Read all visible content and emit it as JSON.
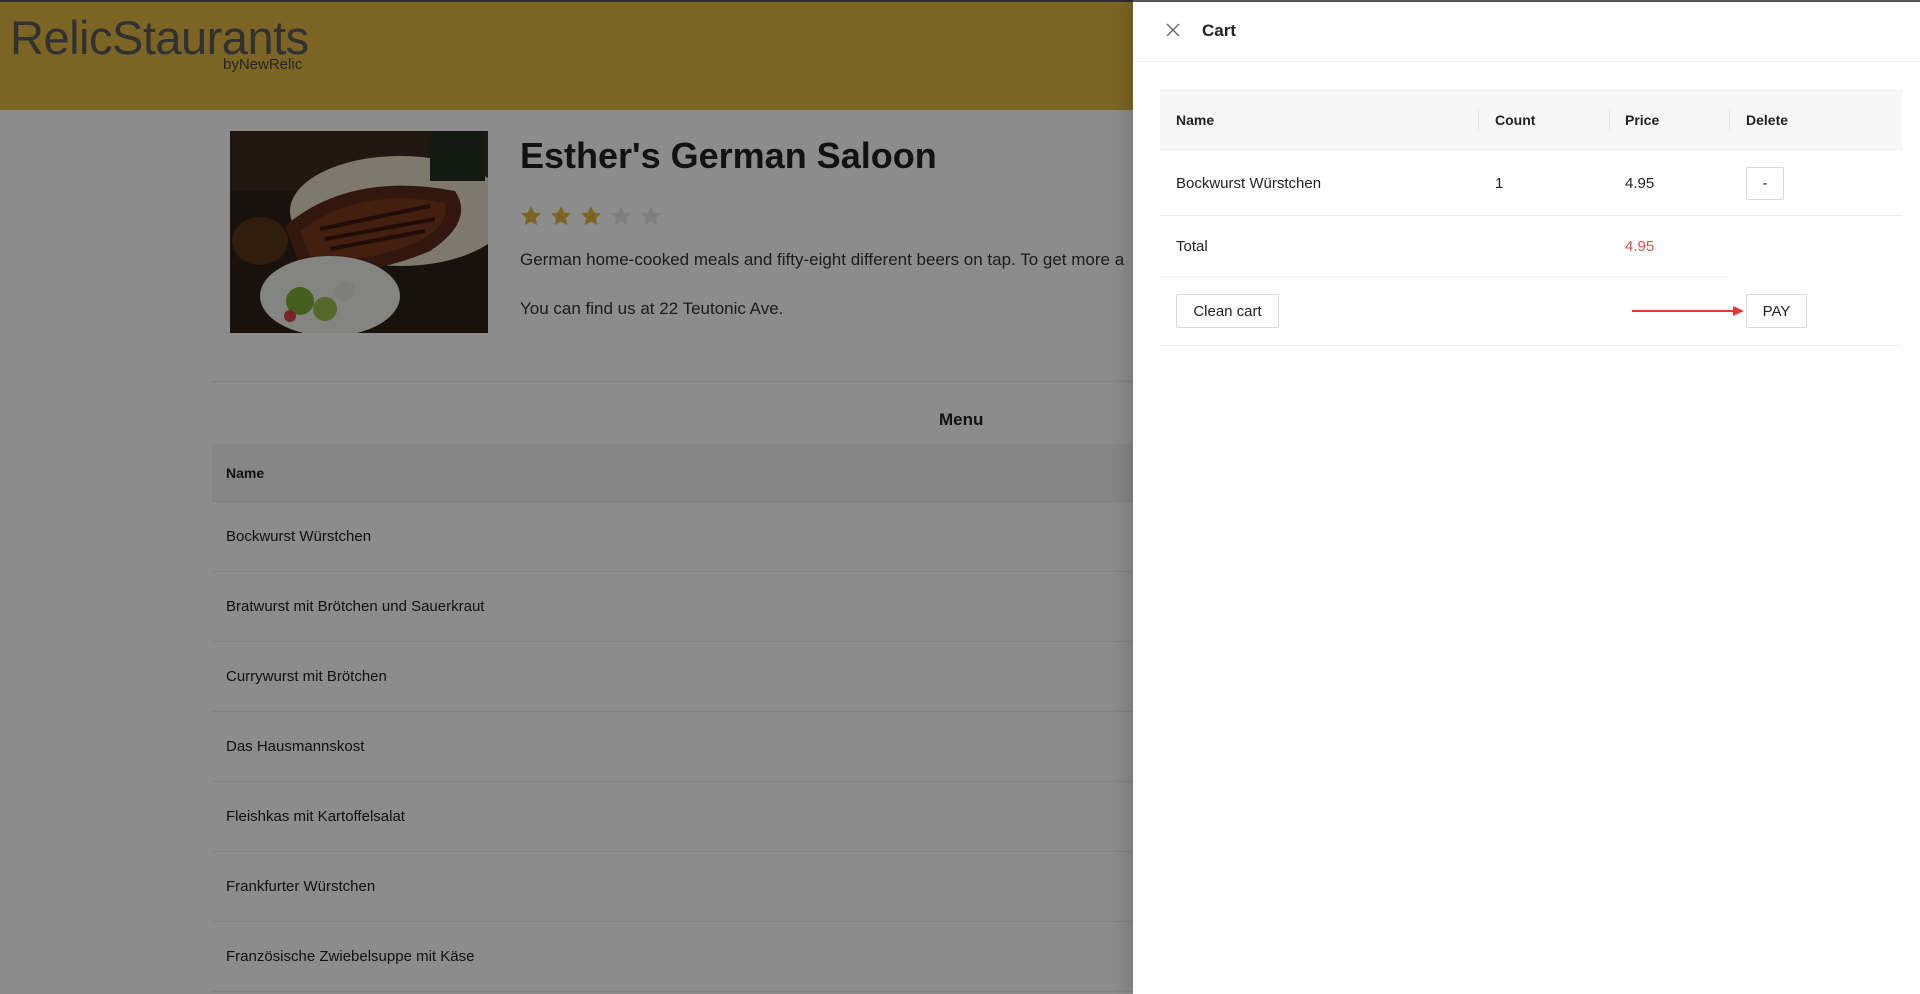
{
  "header": {
    "logo_title": "RelicStaurants",
    "logo_sub": "byNewRelic",
    "color": "#e2b843"
  },
  "restaurant": {
    "name": "Esther's German Saloon",
    "rating": 3,
    "rating_max": 5,
    "description": "German home-cooked meals and fifty-eight different beers on tap. To get more a",
    "address": "You can find us at 22 Teutonic Ave."
  },
  "menu": {
    "title": "Menu",
    "column_name": "Name",
    "items": [
      "Bockwurst Würstchen",
      "Bratwurst mit Brötchen und Sauerkraut",
      "Currywurst mit Brötchen",
      "Das Hausmannskost",
      "Fleishkas mit Kartoffelsalat",
      "Frankfurter Würstchen",
      "Französische Zwiebelsuppe mit Käse"
    ]
  },
  "cart": {
    "title": "Cart",
    "columns": {
      "name": "Name",
      "count": "Count",
      "price": "Price",
      "delete": "Delete"
    },
    "items": [
      {
        "name": "Bockwurst Würstchen",
        "count": "1",
        "price": "4.95",
        "delete_label": "-"
      }
    ],
    "total_label": "Total",
    "total_value": "4.95",
    "clean_label": "Clean cart",
    "pay_label": "PAY",
    "total_color": "#d9534f",
    "arrow_color": "#e03a2a"
  }
}
